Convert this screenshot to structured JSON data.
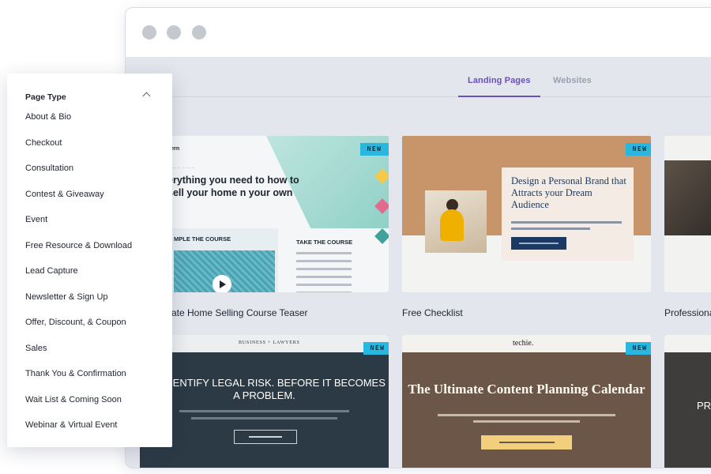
{
  "tabs": [
    {
      "label": "Landing Pages",
      "active": true
    },
    {
      "label": "Websites",
      "active": false
    }
  ],
  "dropdown": {
    "title": "Page Type",
    "expanded": true,
    "items": [
      "About & Bio",
      "Checkout",
      "Consultation",
      "Contest & Giveaway",
      "Event",
      "Free Resource & Download",
      "Lead Capture",
      "Newsletter & Sign Up",
      "Offer, Discount, & Coupon",
      "Sales",
      "Thank You & Confirmation",
      "Wait List & Coming Soon",
      "Webinar & Virtual Event"
    ]
  },
  "badge_label": "NEW",
  "cards": [
    {
      "label": "ate Home Selling Course Teaser",
      "new": true,
      "preview": {
        "logo": "dern",
        "headline": "erything you need to how to sell your home n your own",
        "left_panel": "MPLE THE COURSE",
        "right_panel": "TAKE THE COURSE"
      }
    },
    {
      "label": "Free Checklist",
      "new": true,
      "preview": {
        "headline": "Design a Personal Brand that Attracts your Dream Audience"
      }
    },
    {
      "label": "Professiona",
      "new": false
    },
    {
      "label": "",
      "new": true,
      "preview": {
        "top": "BUSINESS + LAWYERS",
        "headline": "WE IDENTIFY LEGAL RISK. BEFORE IT BECOMES A PROBLEM."
      }
    },
    {
      "label": "",
      "new": true,
      "preview": {
        "top": "techie.",
        "headline": "The Ultimate Content Planning Calendar"
      }
    },
    {
      "label": "",
      "new": false,
      "preview": {
        "headline": "PR"
      }
    }
  ],
  "colors": {
    "accent": "#6b4fbb",
    "badge": "#2ab7df",
    "canvas": "#e4e6ed"
  }
}
